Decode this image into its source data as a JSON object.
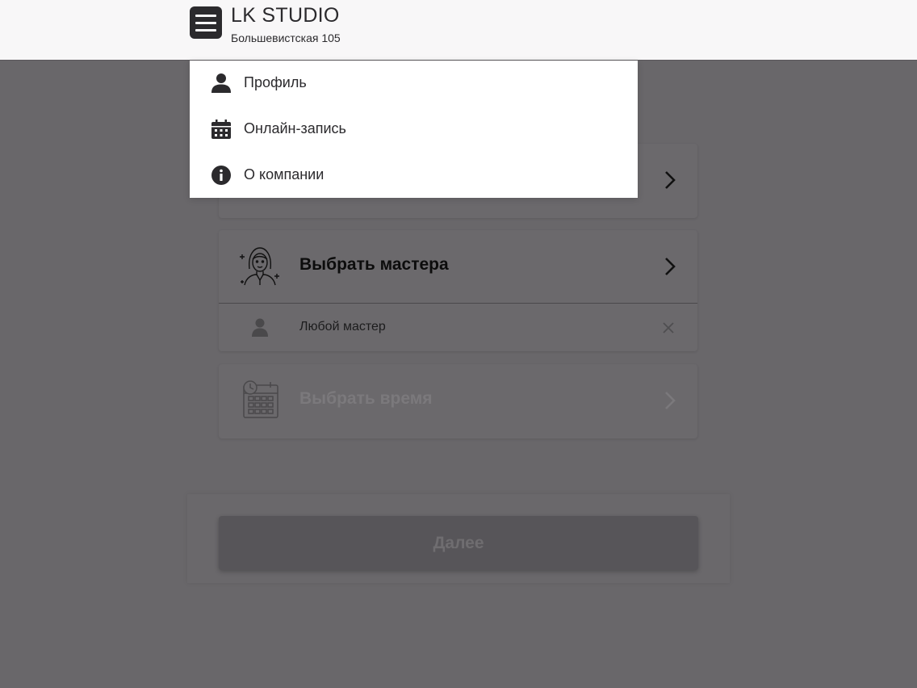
{
  "header": {
    "title": "LK STUDIO",
    "subtitle": "Большевистская 105",
    "menu_icon": "hamburger-icon"
  },
  "menu": {
    "items": [
      {
        "label": "Профиль",
        "icon": "user-icon"
      },
      {
        "label": "Онлайн-запись",
        "icon": "calendar-icon"
      },
      {
        "label": "О компании",
        "icon": "info-icon"
      }
    ]
  },
  "steps": {
    "master": {
      "title": "Выбрать мастера",
      "icon": "master-woman-icon",
      "selected": "Любой мастер"
    },
    "time": {
      "title": "Выбрать время",
      "icon": "calendar-clock-icon"
    }
  },
  "footer": {
    "next_label": "Далее"
  },
  "colors": {
    "overlay": "#69676a",
    "header_bg": "#f8f7f8",
    "menu_button": "#2b2a2d",
    "dropdown_bg": "#ffffff"
  }
}
